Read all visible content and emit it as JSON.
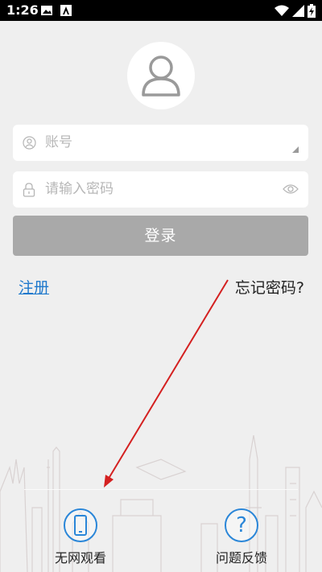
{
  "status_bar": {
    "time": "1:26",
    "icons": [
      "image-icon",
      "a-notification-icon",
      "wifi-icon",
      "signal-icon",
      "battery-icon"
    ]
  },
  "login_form": {
    "account_placeholder": "账号",
    "password_placeholder": "请输入密码",
    "login_label": "登录"
  },
  "links": {
    "register": "注册",
    "forgot_password": "忘记密码?"
  },
  "bottom": {
    "offline_label": "无网观看",
    "feedback_label": "问题反馈",
    "feedback_symbol": "?"
  },
  "colors": {
    "background": "#efefef",
    "login_button": "#a9a9a9",
    "link": "#1e78cc",
    "icon_accent": "#2a86d8",
    "arrow": "#d42020"
  }
}
